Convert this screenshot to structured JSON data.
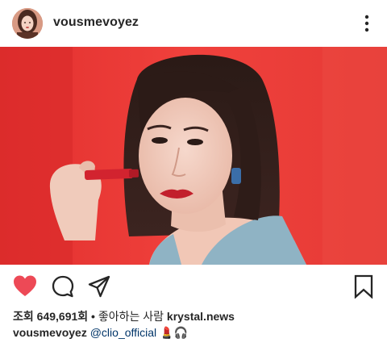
{
  "header": {
    "username": "vousmevoyez",
    "avatar_icon": "profile-avatar",
    "more_icon": "more-vertical-icon"
  },
  "media": {
    "type": "video",
    "description_icon": "photo"
  },
  "actions": {
    "like_icon": "heart-filled-icon",
    "like_color": "#ed4956",
    "comment_icon": "comment-icon",
    "share_icon": "paper-plane-icon",
    "save_icon": "bookmark-icon"
  },
  "stats": {
    "views_label": "조회",
    "views_count": "649,691회",
    "separator": "•",
    "liked_by_label": "좋아하는 사람",
    "liked_by_user": "krystal.news"
  },
  "caption": {
    "username": "vousmevoyez",
    "mention": "@clio_official",
    "emojis": "💄🎧"
  }
}
